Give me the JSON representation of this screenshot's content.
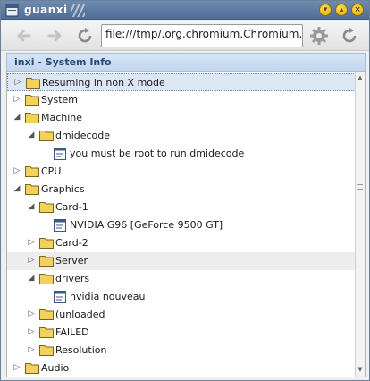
{
  "window": {
    "title": "guanxi"
  },
  "toolbar": {
    "url": "file:///tmp/.org.chromium.Chromium."
  },
  "header": {
    "title": "inxi - System Info"
  },
  "tree": {
    "rows": [
      {
        "label": "Resuming in non X mode"
      },
      {
        "label": "System"
      },
      {
        "label": "Machine"
      },
      {
        "label": "dmidecode"
      },
      {
        "label": "you must be root to run dmidecode"
      },
      {
        "label": "CPU"
      },
      {
        "label": "Graphics"
      },
      {
        "label": "Card-1"
      },
      {
        "label": "NVIDIA G96 [GeForce 9500 GT]"
      },
      {
        "label": "Card-2"
      },
      {
        "label": "Server"
      },
      {
        "label": "drivers"
      },
      {
        "label": "nvidia nouveau"
      },
      {
        "label": "(unloaded"
      },
      {
        "label": "FAILED"
      },
      {
        "label": "Resolution"
      },
      {
        "label": "Audio"
      }
    ]
  },
  "colors": {
    "titlebar": "#5a78a0",
    "folder": "#f2d25a",
    "selection": "#dde7f4"
  }
}
